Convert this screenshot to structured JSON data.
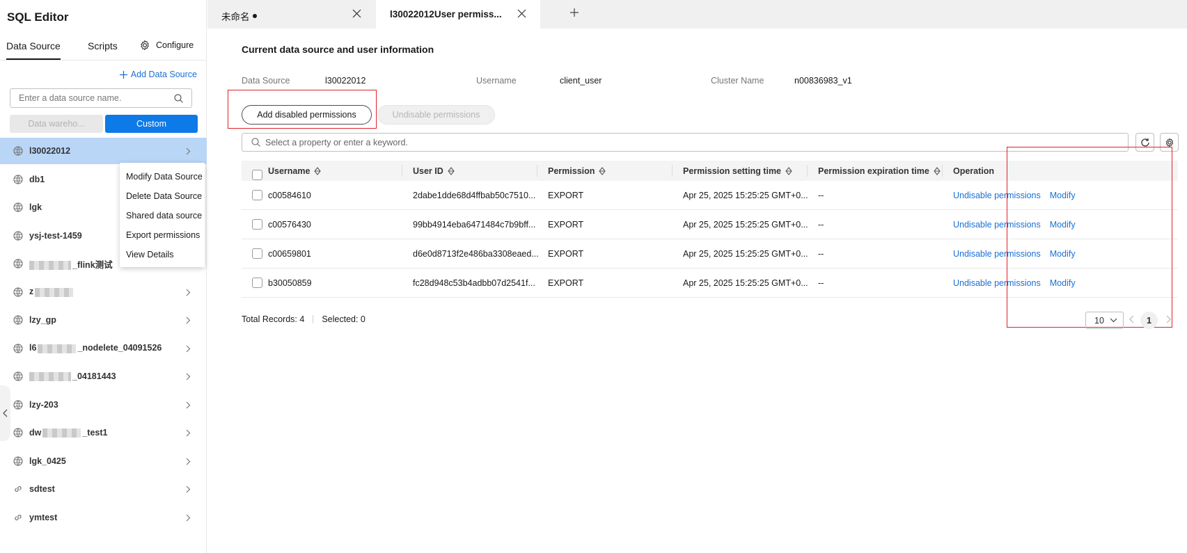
{
  "app": {
    "title": "SQL Editor"
  },
  "sidebar": {
    "tabs": {
      "data_source": "Data Source",
      "scripts": "Scripts"
    },
    "configure_label": "Configure",
    "add_data_source": "Add Data Source",
    "search_placeholder": "Enter a data source name.",
    "segments": {
      "warehouse": "Data wareho...",
      "custom": "Custom"
    },
    "items": [
      {
        "label": "l30022012",
        "icon": "database-icon",
        "active": true
      },
      {
        "label": "db1",
        "icon": "database-icon"
      },
      {
        "label": "lgk",
        "icon": "database-icon"
      },
      {
        "label": "ysj-test-1459",
        "icon": "database-icon"
      },
      {
        "label": "_flink测试",
        "icon": "database-icon",
        "redacted_prefix": true
      },
      {
        "label": "z",
        "icon": "database-icon",
        "redacted_suffix": true
      },
      {
        "label": "lzy_gp",
        "icon": "database-icon"
      },
      {
        "label": "l6",
        "label_suffix": "_nodelete_04091526",
        "icon": "database-icon",
        "redacted_middle": true
      },
      {
        "label": "_04181443",
        "icon": "database-icon",
        "redacted_prefix": true
      },
      {
        "label": "lzy-203",
        "icon": "database-icon"
      },
      {
        "label": "dw",
        "label_suffix": "_test1",
        "icon": "database-icon",
        "redacted_middle": true
      },
      {
        "label": "lgk_0425",
        "icon": "database-icon"
      },
      {
        "label": "sdtest",
        "icon": "link-icon"
      },
      {
        "label": "ymtest",
        "icon": "link-icon"
      }
    ]
  },
  "context_menu": {
    "items": [
      "Modify Data Source",
      "Delete Data Source",
      "Shared data source",
      "Export permissions",
      "View Details"
    ]
  },
  "file_tabs": [
    {
      "label": "未命名",
      "unsaved": true
    },
    {
      "label": "l30022012User permiss...",
      "active": true
    }
  ],
  "main": {
    "section_title": "Current data source and user information",
    "info": {
      "data_source_label": "Data Source",
      "data_source_value": "l30022012",
      "username_label": "Username",
      "username_value": "client_user",
      "cluster_label": "Cluster Name",
      "cluster_value": "n00836983_v1"
    },
    "buttons": {
      "add_disabled": "Add disabled permissions",
      "undisable": "Undisable permissions"
    },
    "filter_placeholder": "Select a property or enter a keyword.",
    "table": {
      "headers": [
        "Username",
        "User ID",
        "Permission",
        "Permission setting time",
        "Permission expiration time",
        "Operation"
      ],
      "rows": [
        {
          "username": "c00584610",
          "user_id": "2dabe1dde68d4ffbab50c7510...",
          "permission": "EXPORT",
          "setting_time": "Apr 25, 2025 15:25:25 GMT+0...",
          "expiration": "--",
          "op1": "Undisable permissions",
          "op2": "Modify"
        },
        {
          "username": "c00576430",
          "user_id": "99bb4914eba6471484c7b9bff...",
          "permission": "EXPORT",
          "setting_time": "Apr 25, 2025 15:25:25 GMT+0...",
          "expiration": "--",
          "op1": "Undisable permissions",
          "op2": "Modify"
        },
        {
          "username": "c00659801",
          "user_id": "d6e0d8713f2e486ba3308eaed...",
          "permission": "EXPORT",
          "setting_time": "Apr 25, 2025 15:25:25 GMT+0...",
          "expiration": "--",
          "op1": "Undisable permissions",
          "op2": "Modify"
        },
        {
          "username": "b30050859",
          "user_id": "fc28d948c53b4adbb07d2541f...",
          "permission": "EXPORT",
          "setting_time": "Apr 25, 2025 15:25:25 GMT+0...",
          "expiration": "--",
          "op1": "Undisable permissions",
          "op2": "Modify"
        }
      ]
    },
    "footer": {
      "total": "Total Records: 4",
      "selected": "Selected: 0",
      "page_size": "10",
      "page": "1"
    }
  },
  "colors": {
    "accent": "#0d7ae8",
    "link": "#1a6fd6",
    "highlight_box": "#e0202a",
    "active_item": "#b9d6f7"
  }
}
